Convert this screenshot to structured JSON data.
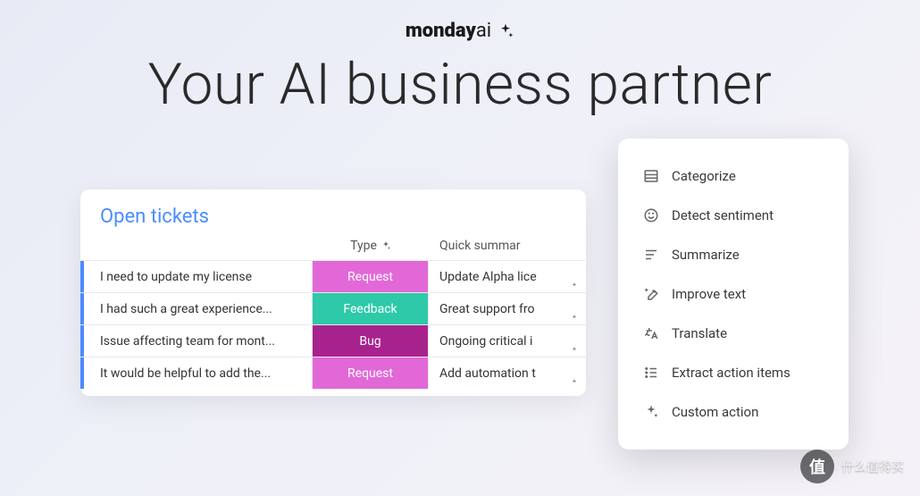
{
  "brand": {
    "name": "monday",
    "suffix": "ai"
  },
  "hero": {
    "title": "Your AI business partner"
  },
  "tickets": {
    "title": "Open tickets",
    "headers": {
      "type": "Type",
      "summary": "Quick summar"
    },
    "rows": [
      {
        "subject": "I need to update my license",
        "type": "Request",
        "typeClass": "type-request",
        "summary": "Update Alpha lice"
      },
      {
        "subject": "I had such a great experience...",
        "type": "Feedback",
        "typeClass": "type-feedback",
        "summary": "Great support fro"
      },
      {
        "subject": "Issue affecting team for mont...",
        "type": "Bug",
        "typeClass": "type-bug",
        "summary": "Ongoing critical i"
      },
      {
        "subject": "It would be helpful to add the...",
        "type": "Request",
        "typeClass": "type-request",
        "summary": "Add automation t"
      }
    ]
  },
  "actions": {
    "items": [
      {
        "label": "Categorize",
        "icon": "categorize"
      },
      {
        "label": "Detect sentiment",
        "icon": "sentiment"
      },
      {
        "label": "Summarize",
        "icon": "summarize"
      },
      {
        "label": "Improve text",
        "icon": "improve"
      },
      {
        "label": "Translate",
        "icon": "translate"
      },
      {
        "label": "Extract action items",
        "icon": "extract"
      },
      {
        "label": "Custom action",
        "icon": "sparkle"
      }
    ]
  },
  "watermark": {
    "badge": "值",
    "text": "什么值得买"
  }
}
